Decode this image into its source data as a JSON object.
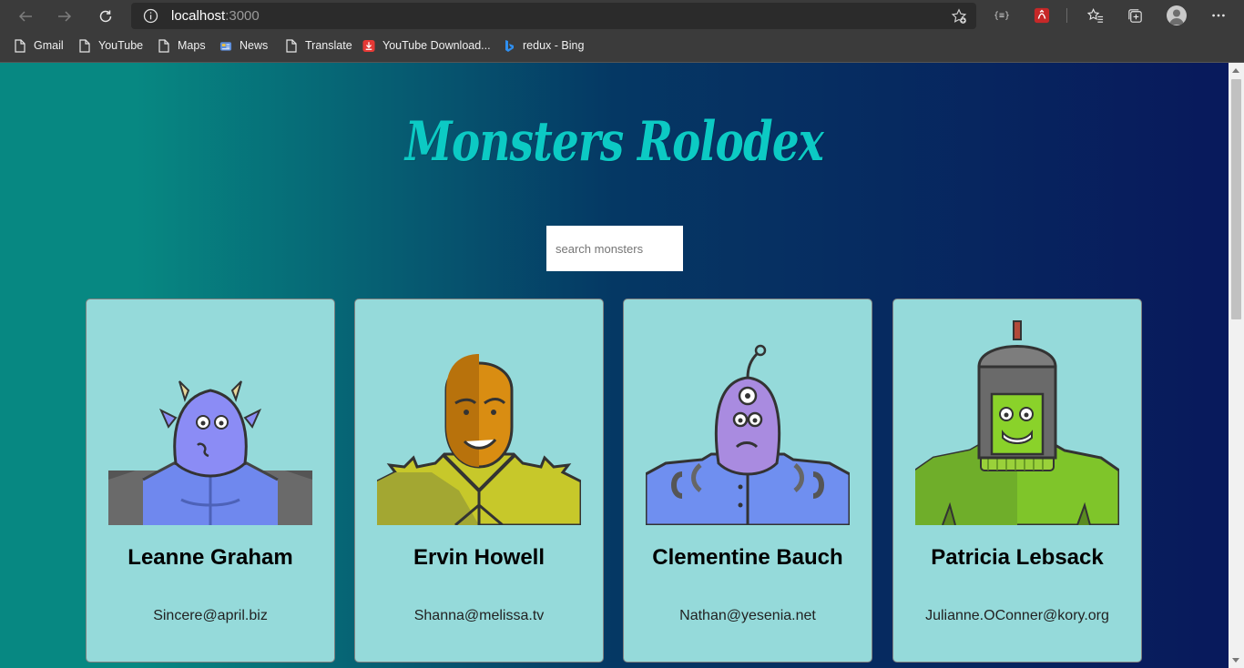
{
  "browser": {
    "url_host": "localhost",
    "url_port": ":3000",
    "bookmarks": [
      {
        "label": "Gmail",
        "icon": "page-icon"
      },
      {
        "label": "YouTube",
        "icon": "page-icon"
      },
      {
        "label": "Maps",
        "icon": "page-icon"
      },
      {
        "label": "News",
        "icon": "news-icon"
      },
      {
        "label": "Translate",
        "icon": "page-icon"
      },
      {
        "label": "YouTube Download...",
        "icon": "download-icon"
      },
      {
        "label": "redux - Bing",
        "icon": "bing-icon"
      }
    ],
    "extension_json_label": "{≡}"
  },
  "app": {
    "title": "Monsters Rolodex",
    "search_placeholder": "search monsters"
  },
  "monsters": [
    {
      "name": "Leanne Graham",
      "email": "Sincere@april.biz",
      "skin": "#8b8cf5",
      "shirt": "#6f88ee"
    },
    {
      "name": "Ervin Howell",
      "email": "Shanna@melissa.tv",
      "skin": "#d98d12",
      "shirt": "#c7c82a"
    },
    {
      "name": "Clementine Bauch",
      "email": "Nathan@yesenia.net",
      "skin": "#a98be0",
      "shirt": "#6f8ff0"
    },
    {
      "name": "Patricia Lebsack",
      "email": "Julianne.OConner@kory.org",
      "skin": "#8ad22a",
      "shirt": "#7fc52a"
    }
  ],
  "colors": {
    "title": "#0ccac4",
    "card_bg": "#95dada",
    "gradient_left": "#078882",
    "gradient_right": "#081a5c"
  }
}
